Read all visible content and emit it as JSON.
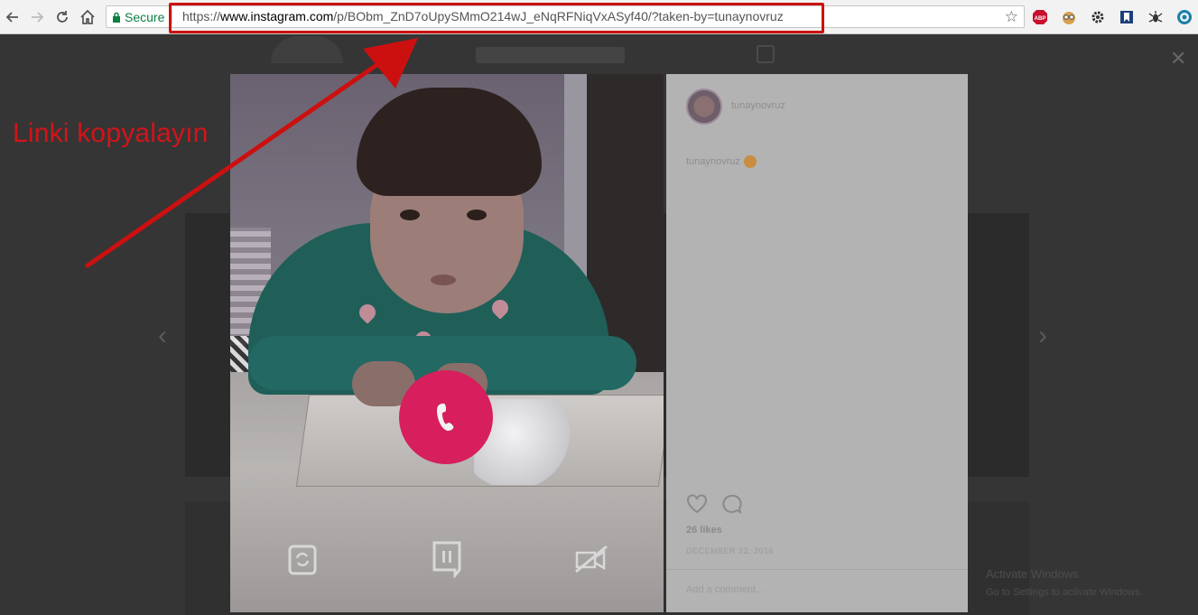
{
  "browser": {
    "security_label": "Secure",
    "url_scheme": "https://",
    "url_host": "www.instagram.com",
    "url_path": "/p/BObm_ZnD7oUpySMmO214wJ_eNqRFNiqVxASyf40/?taken-by=tunaynovruz",
    "extensions": [
      "adblock-plus-icon",
      "reader-icon",
      "gear-icon",
      "bookmark-icon",
      "bug-icon",
      "globe-icon"
    ]
  },
  "annotation": {
    "text": "Linki kopyalayın",
    "color": "#d2141a"
  },
  "video_call": {
    "call_button_color": "#d61f5c",
    "controls": [
      "switch-camera-icon",
      "pause-icon",
      "mute-video-icon"
    ]
  },
  "side_panel": {
    "username": "tunaynovruz",
    "caption_user": "tunaynovruz",
    "likes": "26 likes",
    "timestamp": "DECEMBER 22, 2016",
    "comment_placeholder": "Add a comment..."
  },
  "background": {
    "blurred_lines": [
      "Activate Windows",
      "Go to Settings to activate Windows."
    ]
  }
}
